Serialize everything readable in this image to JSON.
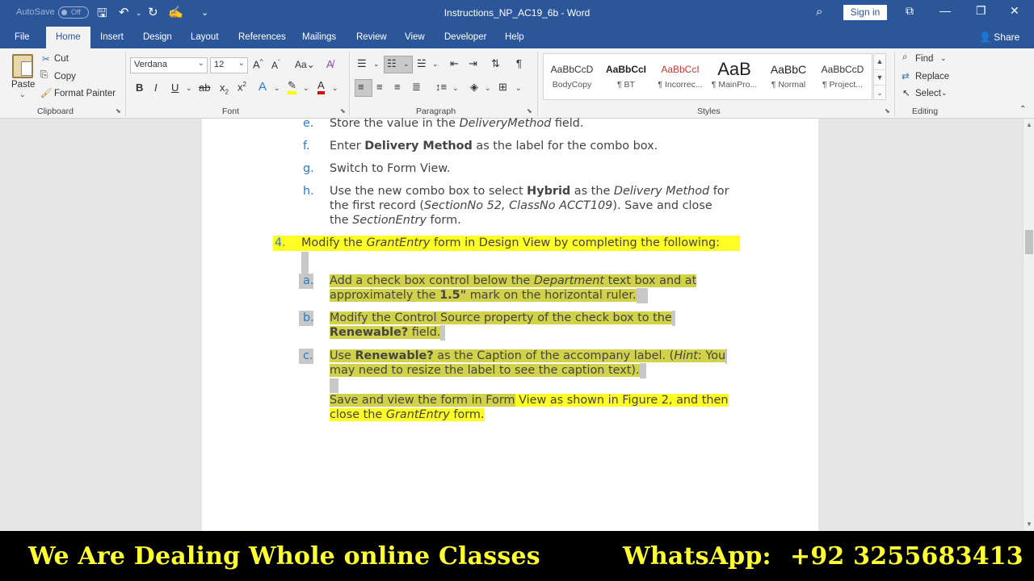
{
  "titlebar": {
    "autosave_label": "AutoSave",
    "autosave_state": "Off",
    "document_title": "Instructions_NP_AC19_6b",
    "separator": " - ",
    "app_name": "Word",
    "signin_label": "Sign in"
  },
  "tabs": [
    "File",
    "Home",
    "Insert",
    "Design",
    "Layout",
    "References",
    "Mailings",
    "Review",
    "View",
    "Developer",
    "Help"
  ],
  "share_label": "Share",
  "clipboard": {
    "paste_label": "Paste",
    "cut_label": "Cut",
    "copy_label": "Copy",
    "format_painter_label": "Format Painter",
    "group_label": "Clipboard"
  },
  "font": {
    "family": "Verdana",
    "size": "12",
    "group_label": "Font"
  },
  "paragraph": {
    "group_label": "Paragraph"
  },
  "styles": {
    "group_label": "Styles",
    "items": [
      {
        "preview": "AaBbCcD",
        "name": "BodyCopy"
      },
      {
        "preview": "AaBbCcI",
        "name": "¶ BT"
      },
      {
        "preview": "AaBbCcI",
        "name": "¶ Incorrec..."
      },
      {
        "preview": "AaB",
        "name": "¶ MainPro..."
      },
      {
        "preview": "AaBbC",
        "name": "¶ Normal"
      },
      {
        "preview": "AaBbCcD",
        "name": "¶ Project..."
      }
    ]
  },
  "editing": {
    "find_label": "Find",
    "replace_label": "Replace",
    "select_label": "Select",
    "group_label": "Editing"
  },
  "document": {
    "item_e": {
      "marker": "e.",
      "t1": "Store the value in the ",
      "t2": "DeliveryMethod",
      "t3": " field."
    },
    "item_f": {
      "marker": "f.",
      "t1": "Enter ",
      "t2": "Delivery Method",
      "t3": " as the label for the combo box."
    },
    "item_g": {
      "marker": "g.",
      "t1": "Switch to Form View."
    },
    "item_h": {
      "marker": "h.",
      "l1_a": "Use the new combo box to select ",
      "l1_b": "Hybrid",
      "l1_c": " as the ",
      "l1_d": "Delivery Method",
      "l1_e": " for",
      "l2_a": "the first record (",
      "l2_b": "SectionNo 52, ClassNo ACCT109",
      "l2_c": "). Save and close",
      "l3_a": "the ",
      "l3_b": "SectionEntry",
      "l3_c": " form."
    },
    "item_4": {
      "marker": "4.",
      "t1": "Modify the ",
      "t2": "GrantEntry",
      "t3": " form in Design View by completing the following:"
    },
    "item_a": {
      "marker": "a.",
      "l1_a": "Add a check box control below the ",
      "l1_b": "Department",
      "l1_c": " text box and at",
      "l2_a": "approximately the ",
      "l2_b": "1.5\"",
      "l2_c": " mark on the horizontal ruler."
    },
    "item_b": {
      "marker": "b.",
      "l1_a": "Modify the Control Source property of the check box to the",
      "l2_a": "Renewable?",
      "l2_b": " field."
    },
    "item_c": {
      "marker": "c.",
      "l1_a": "Use ",
      "l1_b": "Renewable?",
      "l1_c": " as the Caption of the accompany label. (",
      "l1_d": "Hint",
      "l1_e": ": You",
      "l2_a": "may need to resize the label to see the caption text)."
    },
    "item_save": {
      "l1_a": "Save and view the form in Form",
      "l1_b": " View as shown in Figure 2, and then",
      "l2_a": "close the ",
      "l2_b": "GrantEntry",
      "l2_c": " form."
    }
  },
  "banner": {
    "left_text": "We Are Dealing Whole online Classes",
    "right_label": "WhatsApp:",
    "right_number": "+92 3255683413"
  },
  "colors": {
    "word_blue": "#2b579a",
    "highlight_yellow": "#ffff26",
    "banner_text": "#ffff33"
  }
}
